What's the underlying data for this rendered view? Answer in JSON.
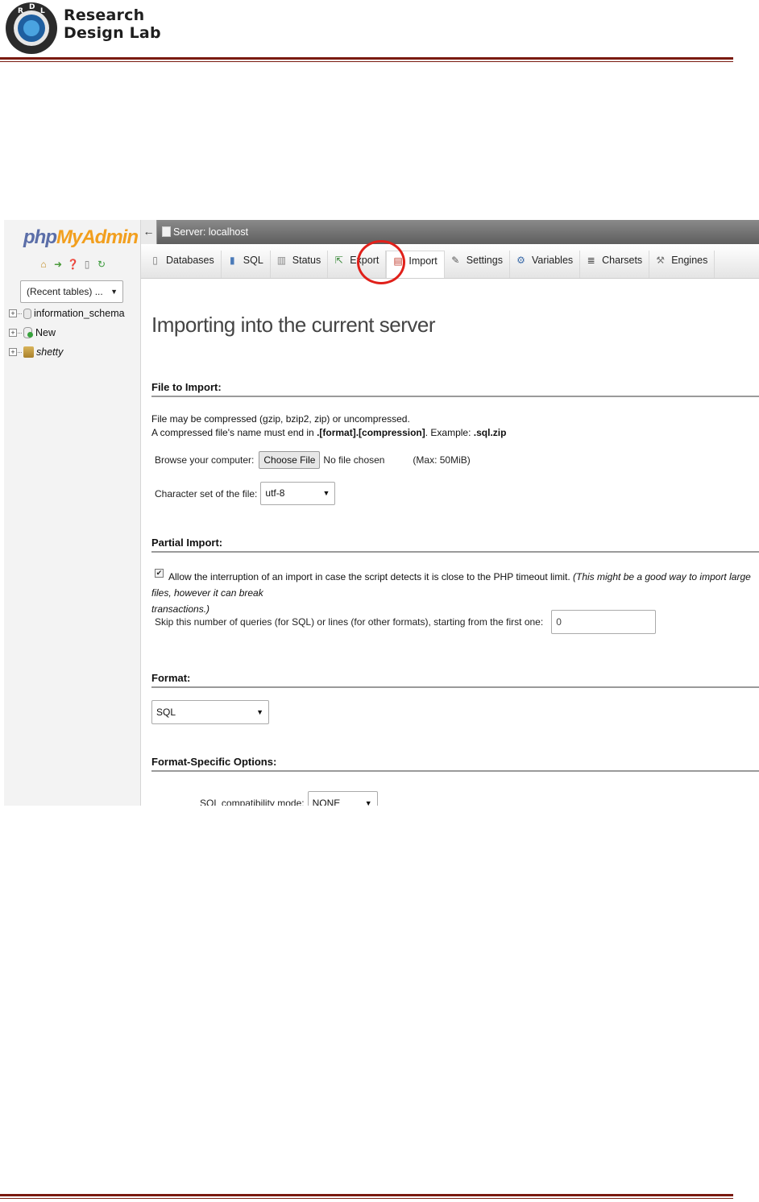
{
  "document_header": {
    "brand_line1": "Research",
    "brand_line2": "Design Lab",
    "seal_letters": "R D L",
    "header_rule_color": "#7a1a10"
  },
  "pma": {
    "logo_php": "php",
    "logo_myadmin": "MyAdmin",
    "nav_icons": [
      "home-icon",
      "logout-icon",
      "help-icon",
      "docs-icon",
      "reload-icon"
    ],
    "recent_tables": "(Recent tables) ...",
    "tree": [
      {
        "name": "information_schema",
        "icon": "database-icon"
      },
      {
        "name": "New",
        "icon": "new-database-icon"
      },
      {
        "name": "shetty",
        "icon": "database-open-icon"
      }
    ],
    "server_bar": {
      "collapse": "←",
      "label": "Server: localhost"
    },
    "tabs": [
      {
        "label": "Databases",
        "icon": "databases-icon"
      },
      {
        "label": "SQL",
        "icon": "sql-icon"
      },
      {
        "label": "Status",
        "icon": "status-icon"
      },
      {
        "label": "Export",
        "icon": "export-icon"
      },
      {
        "label": "Import",
        "icon": "import-icon",
        "active": true
      },
      {
        "label": "Settings",
        "icon": "settings-icon"
      },
      {
        "label": "Variables",
        "icon": "variables-icon"
      },
      {
        "label": "Charsets",
        "icon": "charsets-icon"
      },
      {
        "label": "Engines",
        "icon": "engines-icon"
      }
    ],
    "highlight_color": "#e0201a",
    "page_title": "Importing into the current server",
    "file_to_import": {
      "legend": "File to Import:",
      "line1": "File may be compressed (gzip, bzip2, zip) or uncompressed.",
      "line2_prefix": "A compressed file's name must end in ",
      "line2_format": ".[format].[compression]",
      "line2_example_label": ". Example: ",
      "line2_example": ".sql.zip",
      "browse_label": "Browse your computer:",
      "choose_button": "Choose File",
      "no_file": "No file chosen",
      "max_size": "(Max: 50MiB)",
      "charset_label": "Character set of the file:",
      "charset_value": "utf-8"
    },
    "partial_import": {
      "legend": "Partial Import:",
      "allow_checked": true,
      "allow_text": "Allow the interruption of an import in case the script detects it is close to the PHP timeout limit.",
      "allow_note_line1": "(This might be a good way to import large files, however it can break",
      "allow_note_line2": "transactions.)",
      "skip_label": "Skip this number of queries (for SQL) or lines (for other formats), starting from the first one:",
      "skip_value": "0"
    },
    "format": {
      "legend": "Format:",
      "value": "SQL"
    },
    "format_specific": {
      "legend": "Format-Specific Options:",
      "compat_label": "SQL compatibility mode:",
      "compat_value": "NONE"
    }
  }
}
